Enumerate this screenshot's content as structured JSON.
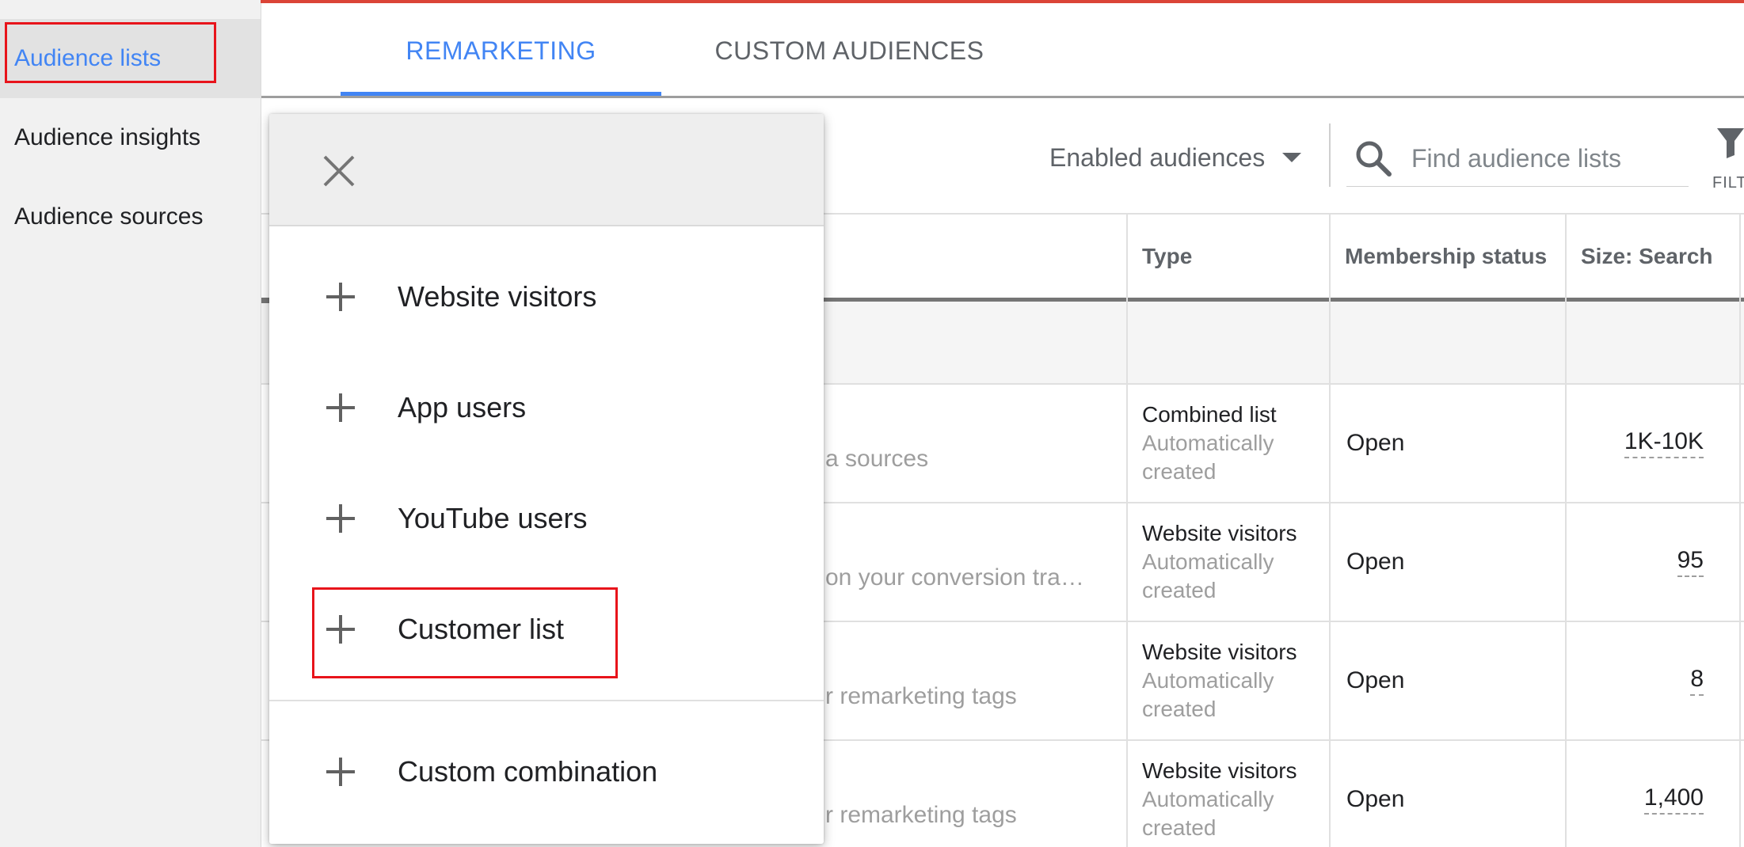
{
  "sidebar": {
    "items": [
      {
        "label": "Audience lists"
      },
      {
        "label": "Audience insights"
      },
      {
        "label": "Audience sources"
      }
    ]
  },
  "tabs": [
    {
      "label": "REMARKETING"
    },
    {
      "label": "CUSTOM AUDIENCES"
    }
  ],
  "toolbar": {
    "status_filter": "Enabled audiences",
    "search_placeholder": "Find audience lists",
    "filter_label": "FILT"
  },
  "table": {
    "headers": {
      "type": "Type",
      "membership": "Membership status",
      "size": "Size: Search"
    },
    "rows": [
      {
        "description": "a sources",
        "type": "Combined list",
        "type_sub": "Automatically created",
        "status": "Open",
        "size": "1K-10K"
      },
      {
        "description": "on your conversion tra…",
        "type": "Website visitors",
        "type_sub": "Automatically created",
        "status": "Open",
        "size": "95"
      },
      {
        "description": "r remarketing tags",
        "type": "Website visitors",
        "type_sub": "Automatically created",
        "status": "Open",
        "size": "8"
      },
      {
        "description": "r remarketing tags",
        "type": "Website visitors",
        "type_sub": "Automatically created",
        "status": "Open",
        "size": "1,400"
      }
    ]
  },
  "menu": {
    "items": [
      {
        "label": "Website visitors"
      },
      {
        "label": "App users"
      },
      {
        "label": "YouTube users"
      },
      {
        "label": "Customer list"
      },
      {
        "label": "Custom combination"
      }
    ]
  },
  "colors": {
    "accent": "#4285f4",
    "highlight": "#e8141b",
    "top_bar": "#db4437"
  }
}
